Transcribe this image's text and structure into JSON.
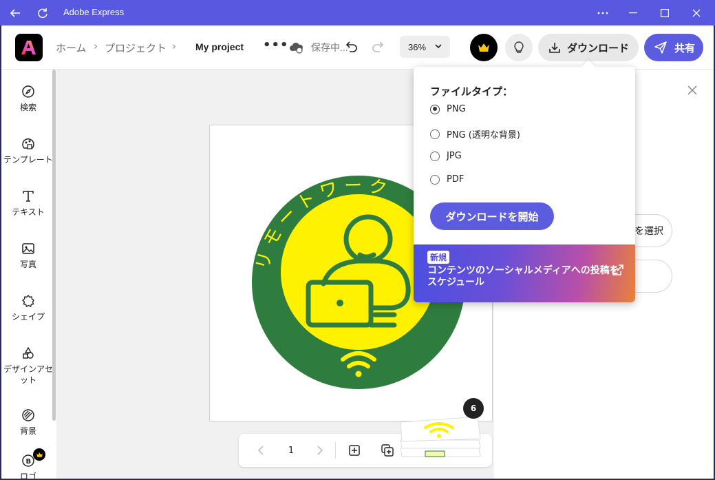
{
  "window": {
    "title": "Adobe Express"
  },
  "header": {
    "breadcrumb": [
      "ホーム",
      "プロジェクト"
    ],
    "project_name": "My project",
    "more": "•••",
    "save_status": "保存中...",
    "zoom": "36%",
    "download_label": "ダウンロード",
    "share_label": "共有"
  },
  "sidebar": {
    "items": [
      {
        "label": "検索",
        "icon": "search-compass-icon"
      },
      {
        "label": "テンプレート",
        "icon": "template-icon"
      },
      {
        "label": "テキスト",
        "icon": "text-icon"
      },
      {
        "label": "写真",
        "icon": "photo-icon"
      },
      {
        "label": "シェイプ",
        "icon": "shape-icon"
      },
      {
        "label": "デザインアセット",
        "icon": "design-assets-icon"
      },
      {
        "label": "背景",
        "icon": "background-icon"
      },
      {
        "label": "ロゴ",
        "icon": "logo-icon"
      }
    ]
  },
  "canvas": {
    "design_text": "リモートワーク",
    "page_number": "1",
    "page_count": "6"
  },
  "download_panel": {
    "title": "ファイルタイプ：",
    "options": [
      {
        "label": "PNG",
        "selected": true
      },
      {
        "label": "PNG (透明な背景)",
        "selected": false
      },
      {
        "label": "JPG",
        "selected": false
      },
      {
        "label": "PDF",
        "selected": false
      }
    ],
    "start_button": "ダウンロードを開始",
    "promo_badge": "新規",
    "promo_text": "コンテンツのソーシャルメディアへの投稿をスケジュール"
  },
  "right_panel": {
    "select_button": "を選択"
  },
  "colors": {
    "accent": "#5c5ce0",
    "titlebar": "#5858e0",
    "badge_green": "#2e7d3e",
    "badge_yellow": "#fff200"
  }
}
